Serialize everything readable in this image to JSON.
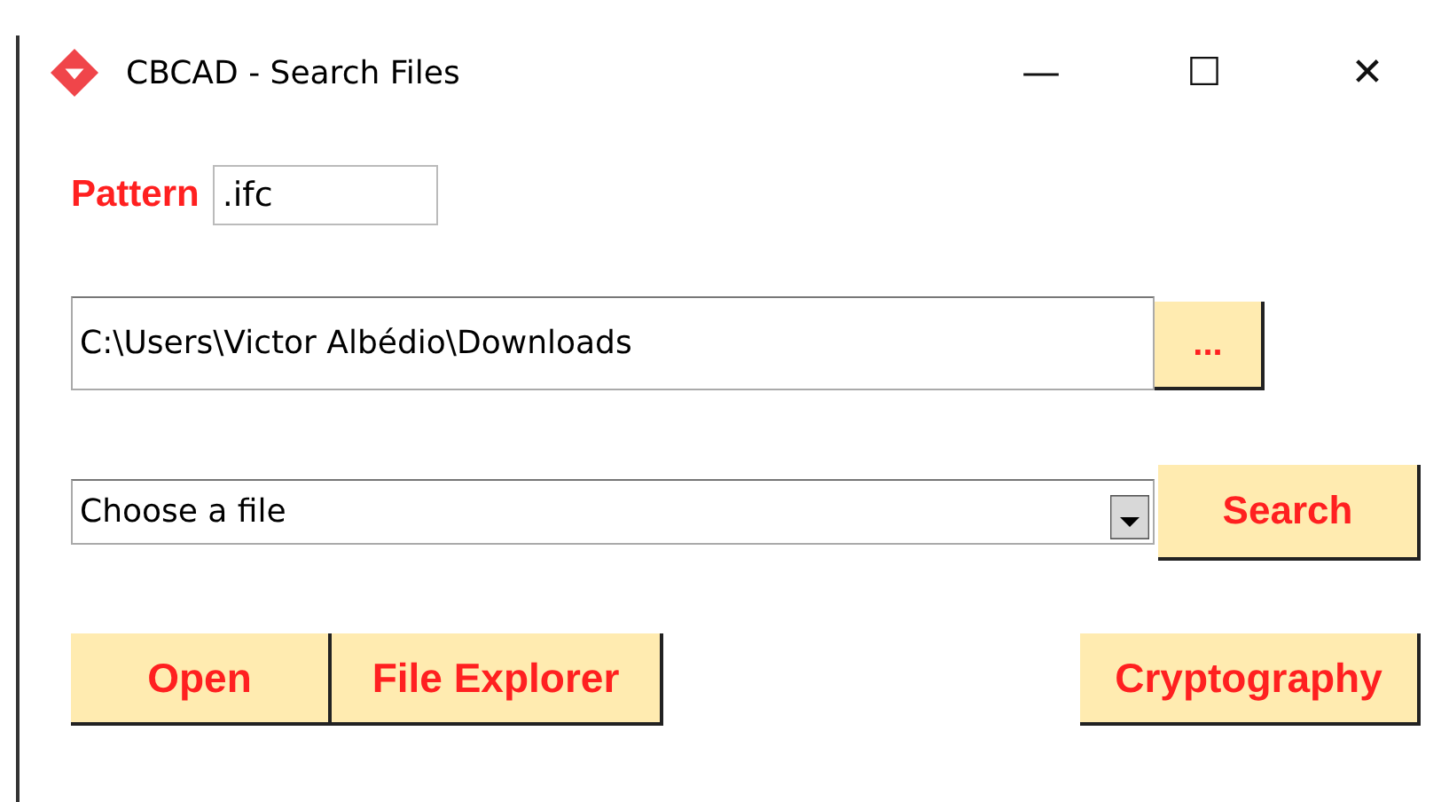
{
  "window": {
    "title": "CBCAD - Search Files",
    "controls": [
      "—",
      "☐",
      "✕"
    ]
  },
  "pattern": {
    "label": "Pattern",
    "value": ".ifc"
  },
  "folder": {
    "value": "C:\\Users\\Victor Albédio\\Downloads",
    "browse_button": "..."
  },
  "file_select": {
    "value": "Choose a file",
    "search_button": "Search"
  },
  "buttons": [
    {
      "label": "Open"
    },
    {
      "label": "File Explorer"
    },
    {
      "label": "Cryptography"
    }
  ]
}
